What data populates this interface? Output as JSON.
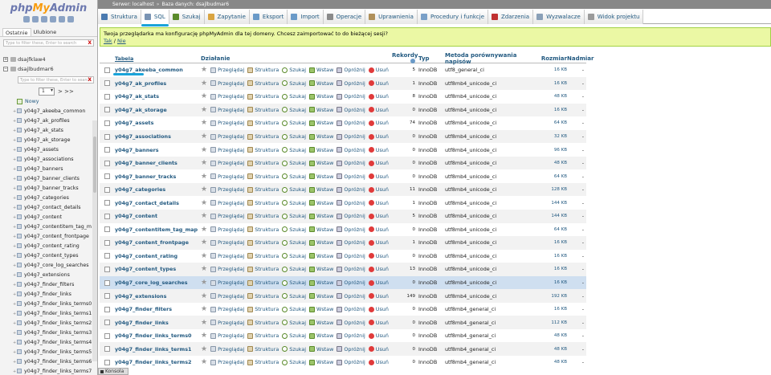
{
  "logo": {
    "php": "php",
    "my": "My",
    "admin": "Admin"
  },
  "nav": {
    "tabs": [
      "Ostatnie",
      "Ulubione"
    ],
    "filter_placeholder": "Type to filter these, Enter to search",
    "databases": [
      {
        "name": "dsajfklaw4",
        "toggle": "+"
      },
      {
        "name": "dsajlbudmar6",
        "toggle": "−"
      }
    ],
    "db_filter_placeholder": "Type to filter these, Enter to search",
    "page_value": "1",
    "page_next": "> >>",
    "new_label": "Nowy",
    "tables": [
      "y04g7_akeeba_common",
      "y04g7_ak_profiles",
      "y04g7_ak_stats",
      "y04g7_ak_storage",
      "y04g7_assets",
      "y04g7_associations",
      "y04g7_banners",
      "y04g7_banner_clients",
      "y04g7_banner_tracks",
      "y04g7_categories",
      "y04g7_contact_details",
      "y04g7_content",
      "y04g7_contentitem_tag_m",
      "y04g7_content_frontpage",
      "y04g7_content_rating",
      "y04g7_content_types",
      "y04g7_core_log_searches",
      "y04g7_extensions",
      "y04g7_finder_filters",
      "y04g7_finder_links",
      "y04g7_finder_links_terms0",
      "y04g7_finder_links_terms1",
      "y04g7_finder_links_terms2",
      "y04g7_finder_links_terms3",
      "y04g7_finder_links_terms4",
      "y04g7_finder_links_terms5",
      "y04g7_finder_links_terms6",
      "y04g7_finder_links_terms7"
    ]
  },
  "breadcrumb": {
    "server": "Serwer: localhost",
    "db": "Baza danych: dsajlbudmar6"
  },
  "tabs": [
    {
      "label": "Struktura",
      "color": "#4a7ab0"
    },
    {
      "label": "SQL",
      "color": "#7a94b4"
    },
    {
      "label": "Szukaj",
      "color": "#5a8a2a"
    },
    {
      "label": "Zapytanie",
      "color": "#d9a441"
    },
    {
      "label": "Eksport",
      "color": "#6a9ac8"
    },
    {
      "label": "Import",
      "color": "#6a9ac8"
    },
    {
      "label": "Operacje",
      "color": "#8a8a8a"
    },
    {
      "label": "Uprawnienia",
      "color": "#b0905a"
    },
    {
      "label": "Procedury i funkcje",
      "color": "#7aa0c8"
    },
    {
      "label": "Zdarzenia",
      "color": "#c03030"
    },
    {
      "label": "Wyzwalacze",
      "color": "#8aa0b8"
    },
    {
      "label": "Widok projektu",
      "color": "#9a9a9a"
    }
  ],
  "notice": {
    "text": "Twoja przeglądarka ma konfigurację phpMyAdmin dla tej domeny. Chcesz zaimportować to do bieżącej sesji?",
    "yes": "Tak",
    "sep": " / ",
    "no": "Nie"
  },
  "table": {
    "headers": {
      "name": "Tabela",
      "actions": "Działanie",
      "records": "Rekordy",
      "type": "Typ",
      "collation": "Metoda porównywania napisów",
      "size": "Rozmiar",
      "overhead": "Nadmiar"
    },
    "action_labels": {
      "browse": "Przeglądaj",
      "structure": "Struktura",
      "search": "Szukaj",
      "insert": "Wstaw",
      "empty": "Opróżnij",
      "drop": "Usuń"
    },
    "rows": [
      {
        "name": "y04g7_akeeba_common",
        "records": "5",
        "type": "InnoDB",
        "collation": "utf8_general_ci",
        "size": "16 KB",
        "overhead": "-"
      },
      {
        "name": "y04g7_ak_profiles",
        "records": "1",
        "type": "InnoDB",
        "collation": "utf8mb4_unicode_ci",
        "size": "16 KB",
        "overhead": "-"
      },
      {
        "name": "y04g7_ak_stats",
        "records": "8",
        "type": "InnoDB",
        "collation": "utf8mb4_unicode_ci",
        "size": "48 KB",
        "overhead": "-"
      },
      {
        "name": "y04g7_ak_storage",
        "records": "0",
        "type": "InnoDB",
        "collation": "utf8mb4_unicode_ci",
        "size": "16 KB",
        "overhead": "-"
      },
      {
        "name": "y04g7_assets",
        "records": "74",
        "type": "InnoDB",
        "collation": "utf8mb4_unicode_ci",
        "size": "64 KB",
        "overhead": "-"
      },
      {
        "name": "y04g7_associations",
        "records": "0",
        "type": "InnoDB",
        "collation": "utf8mb4_unicode_ci",
        "size": "32 KB",
        "overhead": "-"
      },
      {
        "name": "y04g7_banners",
        "records": "0",
        "type": "InnoDB",
        "collation": "utf8mb4_unicode_ci",
        "size": "96 KB",
        "overhead": "-"
      },
      {
        "name": "y04g7_banner_clients",
        "records": "0",
        "type": "InnoDB",
        "collation": "utf8mb4_unicode_ci",
        "size": "48 KB",
        "overhead": "-"
      },
      {
        "name": "y04g7_banner_tracks",
        "records": "0",
        "type": "InnoDB",
        "collation": "utf8mb4_unicode_ci",
        "size": "64 KB",
        "overhead": "-"
      },
      {
        "name": "y04g7_categories",
        "records": "11",
        "type": "InnoDB",
        "collation": "utf8mb4_unicode_ci",
        "size": "128 KB",
        "overhead": "-"
      },
      {
        "name": "y04g7_contact_details",
        "records": "1",
        "type": "InnoDB",
        "collation": "utf8mb4_unicode_ci",
        "size": "144 KB",
        "overhead": "-"
      },
      {
        "name": "y04g7_content",
        "records": "5",
        "type": "InnoDB",
        "collation": "utf8mb4_unicode_ci",
        "size": "144 KB",
        "overhead": "-"
      },
      {
        "name": "y04g7_contentitem_tag_map",
        "records": "0",
        "type": "InnoDB",
        "collation": "utf8mb4_unicode_ci",
        "size": "64 KB",
        "overhead": "-"
      },
      {
        "name": "y04g7_content_frontpage",
        "records": "1",
        "type": "InnoDB",
        "collation": "utf8mb4_unicode_ci",
        "size": "16 KB",
        "overhead": "-"
      },
      {
        "name": "y04g7_content_rating",
        "records": "0",
        "type": "InnoDB",
        "collation": "utf8mb4_unicode_ci",
        "size": "16 KB",
        "overhead": "-"
      },
      {
        "name": "y04g7_content_types",
        "records": "13",
        "type": "InnoDB",
        "collation": "utf8mb4_unicode_ci",
        "size": "16 KB",
        "overhead": "-"
      },
      {
        "name": "y04g7_core_log_searches",
        "records": "0",
        "type": "InnoDB",
        "collation": "utf8mb4_unicode_ci",
        "size": "16 KB",
        "overhead": "-"
      },
      {
        "name": "y04g7_extensions",
        "records": "149",
        "type": "InnoDB",
        "collation": "utf8mb4_unicode_ci",
        "size": "192 KB",
        "overhead": "-"
      },
      {
        "name": "y04g7_finder_filters",
        "records": "0",
        "type": "InnoDB",
        "collation": "utf8mb4_general_ci",
        "size": "16 KB",
        "overhead": "-"
      },
      {
        "name": "y04g7_finder_links",
        "records": "0",
        "type": "InnoDB",
        "collation": "utf8mb4_general_ci",
        "size": "112 KB",
        "overhead": "-"
      },
      {
        "name": "y04g7_finder_links_terms0",
        "records": "0",
        "type": "InnoDB",
        "collation": "utf8mb4_general_ci",
        "size": "48 KB",
        "overhead": "-"
      },
      {
        "name": "y04g7_finder_links_terms1",
        "records": "0",
        "type": "InnoDB",
        "collation": "utf8mb4_general_ci",
        "size": "48 KB",
        "overhead": "-"
      },
      {
        "name": "y04g7_finder_links_terms2",
        "records": "0",
        "type": "InnoDB",
        "collation": "utf8mb4_general_ci",
        "size": "48 KB",
        "overhead": "-"
      }
    ]
  },
  "console": {
    "label": "Konsola"
  }
}
